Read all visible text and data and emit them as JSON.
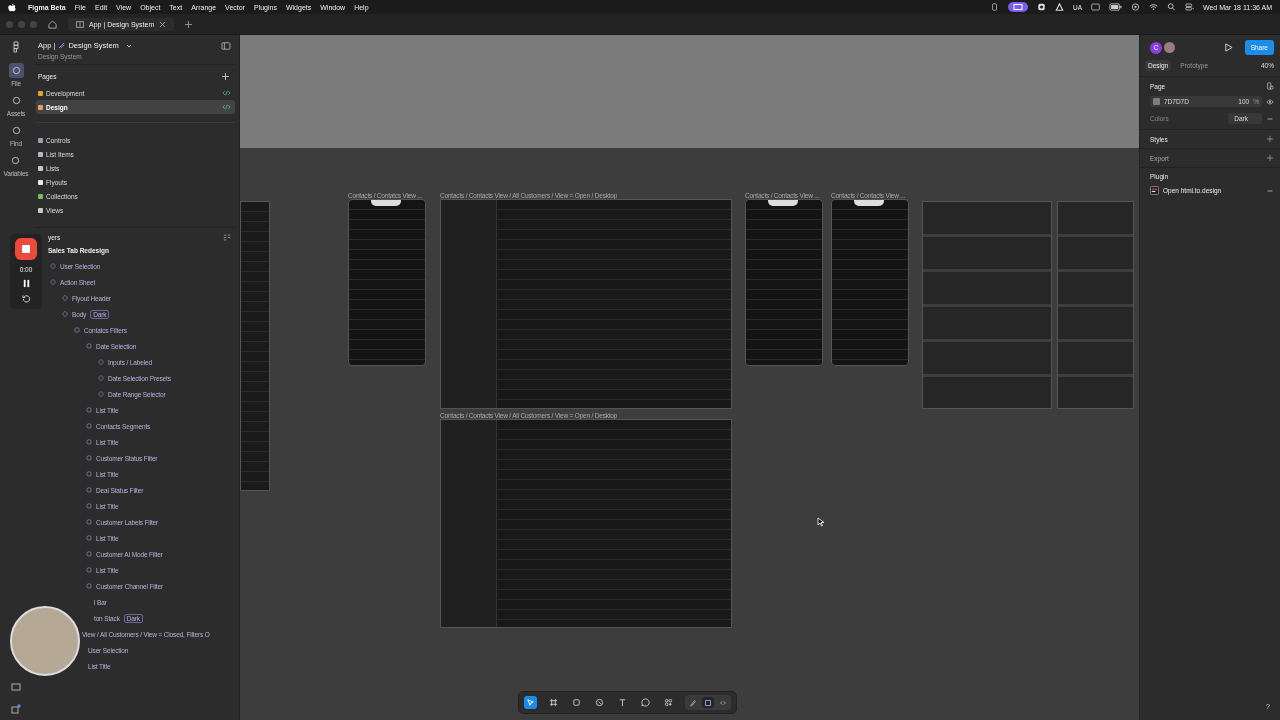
{
  "menu_bar": {
    "app": "Figma Beta",
    "menus": [
      "File",
      "Edit",
      "View",
      "Object",
      "Text",
      "Arrange",
      "Vector",
      "Plugins",
      "Widgets",
      "Window",
      "Help"
    ],
    "keyboard": "UA",
    "clock": "Wed Mar 18  11:36 AM"
  },
  "tabs": [
    {
      "label": "App | Design System",
      "selected": true
    }
  ],
  "rail": [
    {
      "label": "File",
      "selected": true
    },
    {
      "label": "Assets",
      "selected": false
    },
    {
      "label": "Find",
      "selected": false
    },
    {
      "label": "Variables",
      "selected": false
    }
  ],
  "file": {
    "title_left": "App |",
    "title_right": "Design System",
    "subtitle": "Design System"
  },
  "pages": {
    "heading": "Pages",
    "items": [
      {
        "label": "Development",
        "selected": false,
        "color": "#d9a33a",
        "code": true
      },
      {
        "label": "Design",
        "selected": true,
        "color": "#e0a060",
        "code": true
      },
      {
        "label": "Controls",
        "selected": false,
        "color": "#9aa0b0",
        "code": false
      },
      {
        "label": "List Items",
        "selected": false,
        "color": "#b0b8c8",
        "code": false
      },
      {
        "label": "Lists",
        "selected": false,
        "color": "#c8c8c8",
        "code": false
      },
      {
        "label": "Flyouts",
        "selected": false,
        "color": "#e8e8e8",
        "code": false
      },
      {
        "label": "Collections",
        "selected": false,
        "color": "#6fbf5a",
        "code": false
      },
      {
        "label": "Views",
        "selected": false,
        "color": "#c8c8c8",
        "code": false
      }
    ]
  },
  "recorder": {
    "time": "0:00"
  },
  "layers": {
    "heading": "yers",
    "root": "Sales Tab Redesign",
    "tree": [
      {
        "label": "User Selection",
        "kind": "instance"
      },
      {
        "label": "Action Sheet",
        "kind": "instance",
        "children": [
          {
            "label": "Flyout Header",
            "kind": "instance"
          },
          {
            "label": "Body",
            "kind": "instance",
            "badge": "Dark",
            "children": [
              {
                "label": "Contatcs Filters",
                "kind": "frame",
                "children": [
                  {
                    "label": "Date Selection",
                    "kind": "frame",
                    "children": [
                      {
                        "label": "Inputs / Labeled",
                        "kind": "instance"
                      },
                      {
                        "label": "Date Selection Presets",
                        "kind": "instance"
                      },
                      {
                        "label": "Date Range Selector",
                        "kind": "instance"
                      }
                    ]
                  },
                  {
                    "label": "List Title",
                    "kind": "frame"
                  },
                  {
                    "label": "Contacts Segments",
                    "kind": "frame"
                  },
                  {
                    "label": "List Title",
                    "kind": "frame"
                  },
                  {
                    "label": "Customer Status Filter",
                    "kind": "frame"
                  },
                  {
                    "label": "List Title",
                    "kind": "frame"
                  },
                  {
                    "label": "Deal Status Filter",
                    "kind": "frame"
                  },
                  {
                    "label": "List Title",
                    "kind": "frame"
                  },
                  {
                    "label": "Customer Labels Filter",
                    "kind": "frame"
                  },
                  {
                    "label": "List Title",
                    "kind": "frame"
                  },
                  {
                    "label": "Customer AI Mode Filter",
                    "kind": "frame"
                  },
                  {
                    "label": "List Title",
                    "kind": "frame"
                  },
                  {
                    "label": "Customer Channel Filter",
                    "kind": "frame"
                  }
                ]
              }
            ]
          }
        ]
      }
    ],
    "covered": [
      {
        "label": "l Bar",
        "kind": "deep"
      },
      {
        "label": "ton Stack",
        "kind": "deep",
        "badge": "Dark"
      },
      {
        "label": "View / All Customers / View = Closed, Filters O",
        "kind": "wide"
      },
      {
        "label": "User Selection",
        "kind": "mid"
      },
      {
        "label": "List Title",
        "kind": "mid"
      }
    ]
  },
  "canvas": {
    "frames": [
      {
        "kind": "partial"
      },
      {
        "kind": "mobile",
        "label": "Contacts / Contatcs View ..."
      },
      {
        "kind": "desktop",
        "label": "Contacts / Contacts View / All Customers / View = Open / Desktop"
      },
      {
        "kind": "mobile",
        "label": "Contacts / Contacts View ..."
      },
      {
        "kind": "mobile",
        "label": "Contacts / Contacts View ..."
      },
      {
        "kind": "strip"
      },
      {
        "kind": "strip"
      },
      {
        "kind": "desktop",
        "label": "Contacts / Contacts View / All Customers / View = Open / Desktop"
      }
    ]
  },
  "toolbar": {
    "tools": [
      {
        "kind": "move",
        "selected": true
      },
      {
        "kind": "frame",
        "selected": false
      },
      {
        "kind": "shape",
        "selected": false
      },
      {
        "kind": "pen",
        "selected": false
      },
      {
        "kind": "text",
        "selected": false
      },
      {
        "kind": "comment",
        "selected": false
      },
      {
        "kind": "actions",
        "selected": false
      }
    ],
    "modes": [
      {
        "kind": "draw",
        "selected": false
      },
      {
        "kind": "design",
        "selected": true
      },
      {
        "kind": "dev",
        "selected": false
      }
    ]
  },
  "right_panel": {
    "avatar": "C",
    "share": "Share",
    "tabs": [
      {
        "label": "Design",
        "selected": true
      },
      {
        "label": "Prototype",
        "selected": false
      }
    ],
    "zoom": "40%",
    "page_heading": "Page",
    "page_color": "7D7D7D",
    "page_opacity": "100",
    "percent": "%",
    "colors_label": "Colors",
    "colors_value": "Dark",
    "sections": [
      "Styles",
      "Export"
    ],
    "plugin_heading": "Plugin",
    "plugin": "Open html.to.design"
  },
  "help": "?"
}
